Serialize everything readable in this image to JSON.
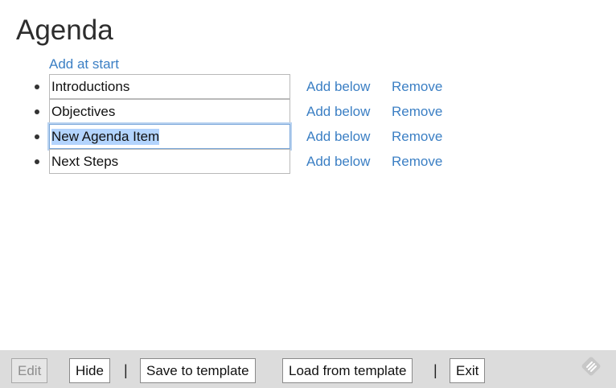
{
  "page": {
    "title": "Agenda",
    "add_at_start_label": "Add at start"
  },
  "agenda": {
    "add_below_label": "Add below",
    "remove_label": "Remove",
    "items": [
      {
        "value": "Introductions"
      },
      {
        "value": "Objectives"
      },
      {
        "value": "New Agenda Item"
      },
      {
        "value": "Next Steps"
      }
    ]
  },
  "toolbar": {
    "edit_label": "Edit",
    "hide_label": "Hide",
    "save_template_label": "Save to template",
    "load_template_label": "Load from template",
    "exit_label": "Exit",
    "separator": "|",
    "logo_icon": "feed-logo-icon"
  },
  "colors": {
    "link": "#3b7fc4",
    "toolbar_bg": "#dcdcdc",
    "focus_ring": "#7aa7da",
    "selection": "#b3d4fd"
  }
}
